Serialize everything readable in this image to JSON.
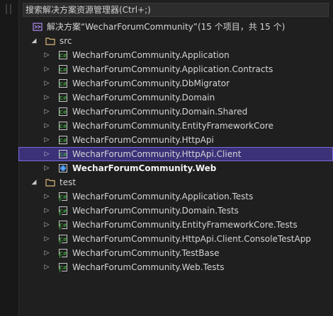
{
  "search": {
    "placeholder": "搜索解决方案资源管理器(Ctrl+;)"
  },
  "solution": {
    "label": "解决方案“WecharForumCommunity”(15 个项目，共 15 个)"
  },
  "folders": {
    "src": "src",
    "test": "test"
  },
  "src_projects": [
    "WecharForumCommunity.Application",
    "WecharForumCommunity.Application.Contracts",
    "WecharForumCommunity.DbMigrator",
    "WecharForumCommunity.Domain",
    "WecharForumCommunity.Domain.Shared",
    "WecharForumCommunity.EntityFrameworkCore",
    "WecharForumCommunity.HttpApi",
    "WecharForumCommunity.HttpApi.Client",
    "WecharForumCommunity.Web"
  ],
  "test_projects": [
    "WecharForumCommunity.Application.Tests",
    "WecharForumCommunity.Domain.Tests",
    "WecharForumCommunity.EntityFrameworkCore.Tests",
    "WecharForumCommunity.HttpApi.Client.ConsoleTestApp",
    "WecharForumCommunity.TestBase",
    "WecharForumCommunity.Web.Tests"
  ],
  "selected_project": "WecharForumCommunity.HttpApi.Client",
  "startup_project": "WecharForumCommunity.Web",
  "colors": {
    "background": "#1f1f1f",
    "selection": "#3b3179",
    "selection_border": "#7a6bdc",
    "csharp_project": "#3c9b3c",
    "folder": "#dcb67a"
  }
}
